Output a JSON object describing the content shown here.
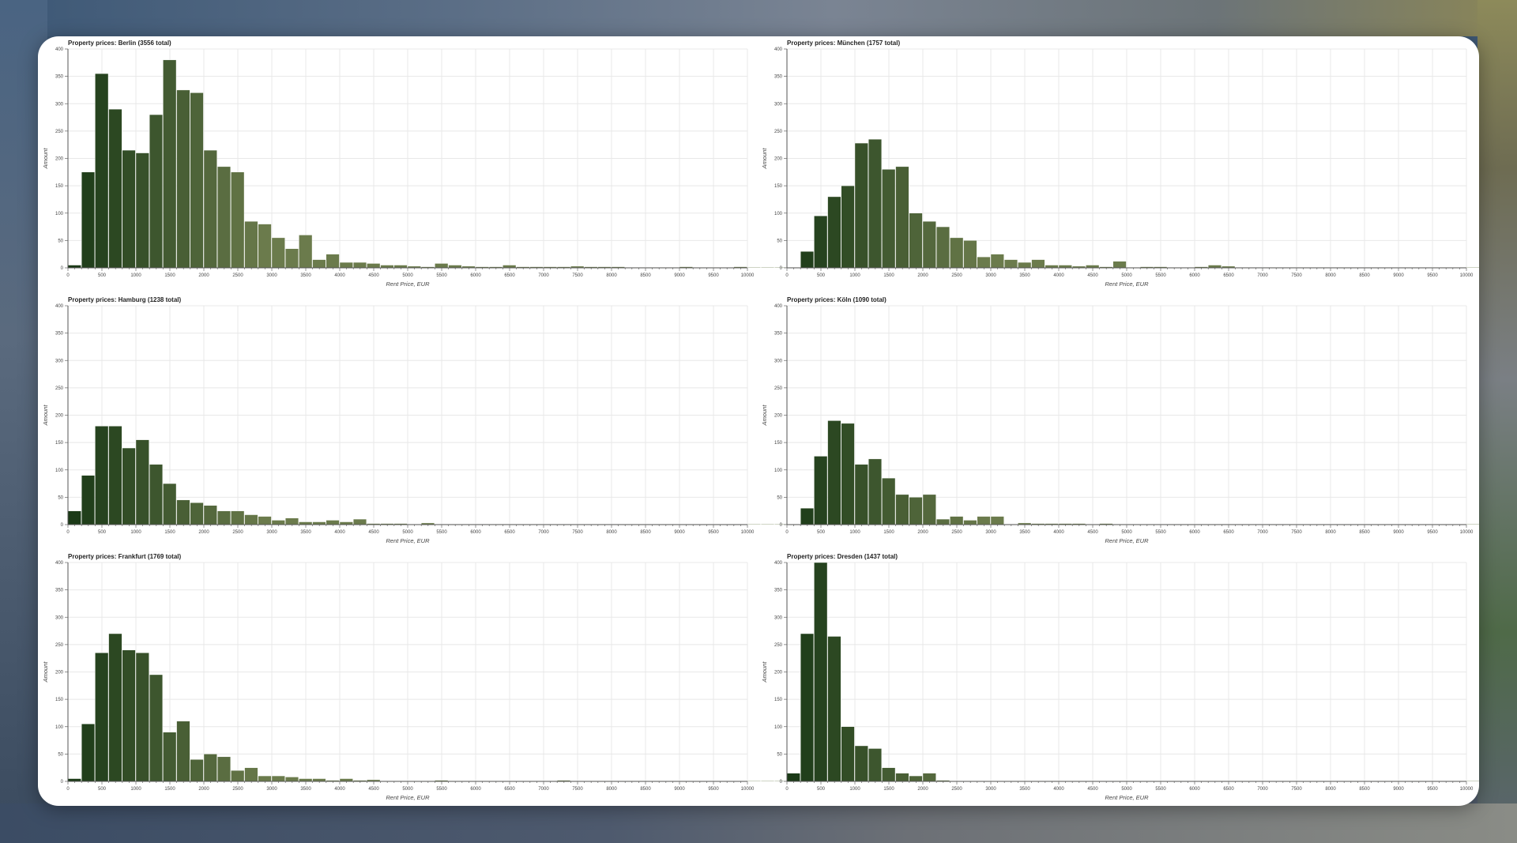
{
  "chart_data": [
    {
      "type": "bar",
      "title": "Property prices: Berlin (3556 total)",
      "xlabel": "Rent Price, EUR",
      "ylabel": "Amount",
      "xlim": [
        0,
        10000
      ],
      "ylim": [
        0,
        400
      ],
      "bin_width": 200,
      "grid": true,
      "color_start": "#1b3a17",
      "color_end": "#6b7b4c",
      "values": [
        5,
        175,
        355,
        290,
        215,
        210,
        280,
        380,
        325,
        320,
        215,
        185,
        175,
        85,
        80,
        55,
        35,
        60,
        15,
        25,
        10,
        10,
        8,
        5,
        5,
        3,
        2,
        8,
        5,
        3,
        2,
        2,
        5,
        2,
        2,
        2,
        2,
        3,
        2,
        2,
        2,
        1,
        1,
        1,
        1,
        2,
        1,
        1,
        1,
        2,
        1,
        1,
        1,
        1,
        1,
        1,
        1,
        1,
        1,
        1
      ]
    },
    {
      "type": "bar",
      "title": "Property prices: München (1757 total)",
      "xlabel": "Rent Price, EUR",
      "ylabel": "Amount",
      "xlim": [
        0,
        10000
      ],
      "ylim": [
        0,
        400
      ],
      "bin_width": 200,
      "grid": true,
      "color_start": "#1b3a17",
      "color_end": "#6b7b4c",
      "values": [
        0,
        30,
        95,
        130,
        150,
        228,
        235,
        180,
        185,
        100,
        85,
        75,
        55,
        50,
        20,
        25,
        15,
        10,
        15,
        5,
        5,
        3,
        5,
        2,
        12,
        1,
        2,
        2,
        1,
        1,
        2,
        5,
        3,
        1,
        1,
        1,
        1,
        1,
        1,
        1,
        1,
        1,
        1,
        1,
        1,
        1,
        1,
        1,
        1,
        1,
        1,
        1,
        1,
        1,
        1,
        1,
        1,
        1,
        1,
        1
      ]
    },
    {
      "type": "bar",
      "title": "Property prices: Hamburg (1238 total)",
      "xlabel": "Rent Price, EUR",
      "ylabel": "Amount",
      "xlim": [
        0,
        10000
      ],
      "ylim": [
        0,
        400
      ],
      "bin_width": 200,
      "grid": true,
      "color_start": "#1b3a17",
      "color_end": "#6b7b4c",
      "values": [
        25,
        90,
        180,
        180,
        140,
        155,
        110,
        75,
        45,
        40,
        35,
        25,
        25,
        18,
        15,
        8,
        12,
        5,
        5,
        8,
        5,
        10,
        2,
        2,
        2,
        1,
        3,
        1,
        1,
        1,
        1,
        1,
        1,
        1,
        1,
        1,
        1,
        1,
        1,
        1,
        1,
        1,
        1,
        1,
        1,
        1,
        1,
        1,
        1,
        1,
        1,
        1,
        1,
        1,
        1,
        1,
        1,
        1,
        1,
        1
      ]
    },
    {
      "type": "bar",
      "title": "Property prices: Köln (1090 total)",
      "xlabel": "Rent Price, EUR",
      "ylabel": "Amount",
      "xlim": [
        0,
        10000
      ],
      "ylim": [
        0,
        400
      ],
      "bin_width": 200,
      "grid": true,
      "color_start": "#1b3a17",
      "color_end": "#6b7b4c",
      "values": [
        0,
        30,
        125,
        190,
        185,
        110,
        120,
        85,
        55,
        50,
        55,
        10,
        15,
        8,
        15,
        15,
        1,
        3,
        2,
        2,
        2,
        2,
        1,
        2,
        1,
        1,
        1,
        1,
        1,
        1,
        1,
        1,
        1,
        1,
        1,
        1,
        1,
        1,
        1,
        1,
        1,
        1,
        1,
        1,
        1,
        1,
        1,
        1,
        1,
        1,
        1,
        1,
        1,
        1,
        1,
        1,
        1,
        1,
        1,
        1
      ]
    },
    {
      "type": "bar",
      "title": "Property prices: Frankfurt (1769 total)",
      "xlabel": "Rent Price, EUR",
      "ylabel": "Amount",
      "xlim": [
        0,
        10000
      ],
      "ylim": [
        0,
        400
      ],
      "bin_width": 200,
      "grid": true,
      "color_start": "#1b3a17",
      "color_end": "#6b7b4c",
      "values": [
        5,
        105,
        235,
        270,
        240,
        235,
        195,
        90,
        110,
        40,
        50,
        45,
        20,
        25,
        10,
        10,
        8,
        5,
        5,
        2,
        5,
        2,
        3,
        1,
        1,
        1,
        1,
        2,
        1,
        1,
        1,
        1,
        1,
        1,
        1,
        1,
        2,
        1,
        1,
        1,
        1,
        1,
        1,
        1,
        1,
        1,
        1,
        1,
        1,
        1,
        1,
        1,
        1,
        1,
        1,
        1,
        1,
        1,
        1,
        1
      ]
    },
    {
      "type": "bar",
      "title": "Property prices: Dresden (1437 total)",
      "xlabel": "Rent Price, EUR",
      "ylabel": "Amount",
      "xlim": [
        0,
        10000
      ],
      "ylim": [
        0,
        400
      ],
      "bin_width": 200,
      "grid": true,
      "color_start": "#1b3a17",
      "color_end": "#6b7b4c",
      "values": [
        15,
        270,
        400,
        265,
        100,
        65,
        60,
        25,
        15,
        10,
        15,
        2,
        1,
        1,
        1,
        1,
        1,
        1,
        1,
        1,
        1,
        1,
        1,
        1,
        1,
        1,
        1,
        1,
        1,
        1,
        1,
        1,
        1,
        1,
        1,
        1,
        1,
        1,
        1,
        1,
        1,
        1,
        1,
        1,
        1,
        1,
        1,
        1,
        1,
        1,
        1,
        1,
        1,
        1,
        1,
        1,
        1,
        1,
        1,
        1
      ]
    }
  ],
  "ticks": {
    "x": [
      "0",
      "500",
      "1000",
      "1500",
      "2000",
      "2500",
      "3000",
      "3500",
      "4000",
      "4500",
      "5000",
      "5500",
      "6000",
      "6500",
      "7000",
      "7500",
      "8000",
      "8500",
      "9000",
      "9500",
      "10000"
    ],
    "y": [
      "0",
      "50",
      "100",
      "150",
      "200",
      "250",
      "300",
      "350",
      "400"
    ]
  }
}
